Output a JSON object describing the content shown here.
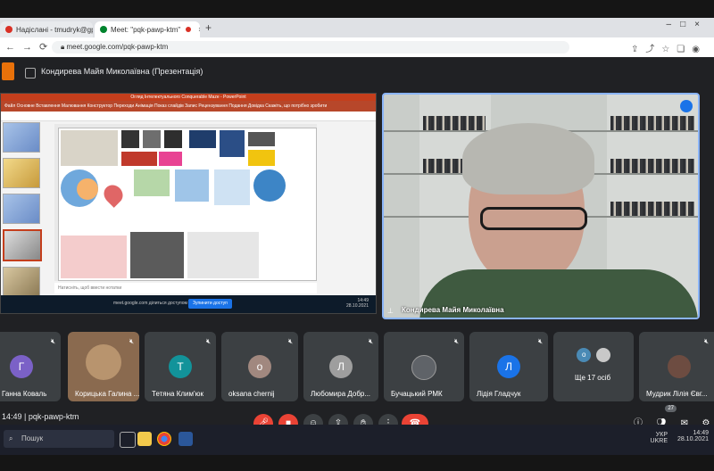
{
  "browser": {
    "tabs": [
      {
        "label": "Надіслані - tmudryk@gppc.edu.",
        "color": "#d93025"
      },
      {
        "label": "Meet: \"pqk-pawp-ktm\"",
        "color": "#00832d"
      }
    ],
    "url": "meet.google.com/pqk-pawp-ktm"
  },
  "meet_header": {
    "presenter_title": "Кондирева Майя Миколаївна (Презентація)"
  },
  "slide": {
    "ppt_title": "Огляд Інтелектуального Conquerable Maze - PowerPoint",
    "ribbon": "Файл  Основне  Вставлення  Малювання  Конструктор  Переходи  Анімація  Показ слайдів  Запис  Рецензування  Подання  Довідка  Скажіть, що потрібно зробити",
    "notes_placeholder": "Натисніть, щоб ввести нотатки",
    "share_message": "meet.google.com ділиться доступом до вашого екрана",
    "share_button": "Зупинити доступ",
    "clock_time": "14:49",
    "clock_date": "28.10.2021"
  },
  "speaker": {
    "name": "Кондирева Майя Миколаївна"
  },
  "participants": [
    {
      "name": "Ганна Коваль",
      "initial": "Г",
      "color": "#7b61c7"
    },
    {
      "name": "Корицька Галина ...",
      "initial": "",
      "color": "#b8946e"
    },
    {
      "name": "Тетяна Клим'юк",
      "initial": "Т",
      "color": "#12939a"
    },
    {
      "name": "oksana chernij",
      "initial": "o",
      "color": "#a1887f"
    },
    {
      "name": "Любомира Добр...",
      "initial": "Л",
      "color": "#9e9e9e"
    },
    {
      "name": "Бучацький РМК",
      "initial": "",
      "color": "#5f6368"
    },
    {
      "name": "Лідія Гладчук",
      "initial": "Л",
      "color": "#1a73e8"
    },
    {
      "name": "Ще 17 осіб",
      "initial": "o",
      "color": "#4a8ab5"
    },
    {
      "name": "Мудрик Лілія Євг...",
      "initial": "",
      "color": "#6d4c41"
    }
  ],
  "bottom_bar": {
    "time": "14:49",
    "meeting_code": "pqk-pawp-ktm",
    "participant_count": "27"
  },
  "taskbar": {
    "search_placeholder": "Пошук",
    "lang_line1": "УКР",
    "lang_line2": "UKRE",
    "time": "14:49",
    "date": "28.10.2021"
  }
}
